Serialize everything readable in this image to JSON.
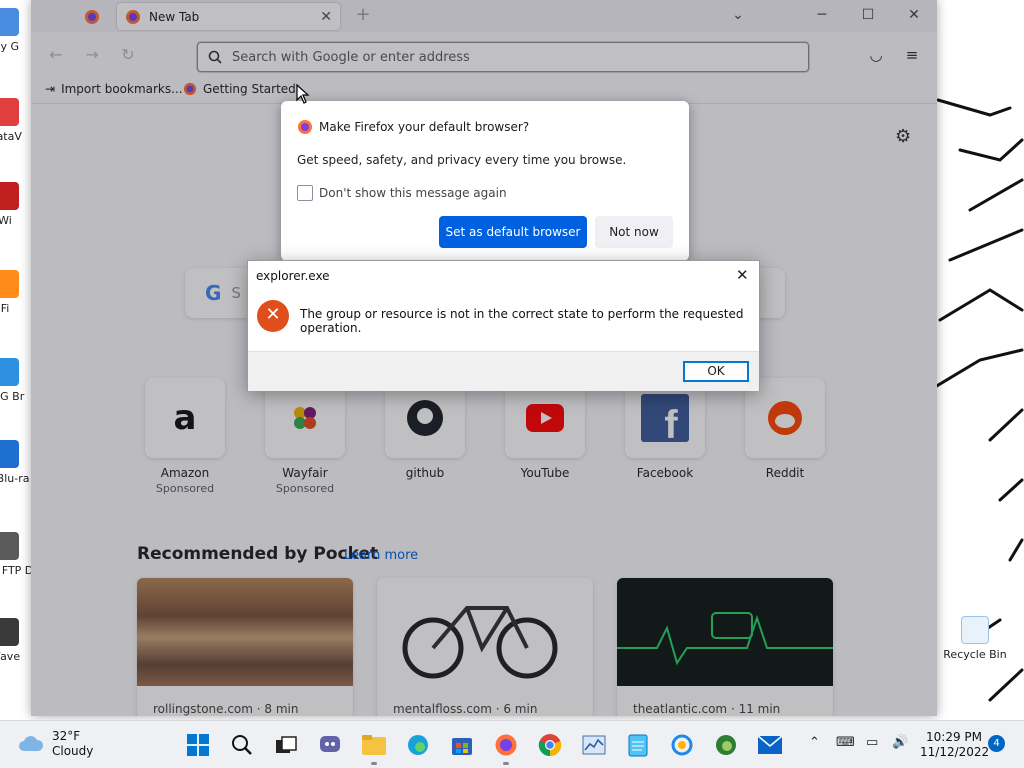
{
  "desktop": {
    "icons": [
      {
        "label": "My G"
      },
      {
        "label": "DataV"
      },
      {
        "label": "Wi"
      },
      {
        "label": "Fi"
      },
      {
        "label": "AVG Br"
      },
      {
        "label": "Le Blu-ra"
      },
      {
        "label": "Guil FTP D"
      },
      {
        "label": "Wave"
      }
    ],
    "recycle_bin": "Recycle Bin"
  },
  "firefox": {
    "tab_title": "New Tab",
    "url_placeholder": "Search with Google or enter address",
    "bookmarks": [
      "Import bookmarks...",
      "Getting Started"
    ],
    "search_placeholder": "S",
    "top_sites": [
      {
        "name": "Amazon",
        "sponsored": "Sponsored"
      },
      {
        "name": "Wayfair",
        "sponsored": "Sponsored"
      },
      {
        "name": "github",
        "sponsored": ""
      },
      {
        "name": "YouTube",
        "sponsored": ""
      },
      {
        "name": "Facebook",
        "sponsored": ""
      },
      {
        "name": "Reddit",
        "sponsored": ""
      }
    ],
    "pocket": {
      "title": "Recommended by Pocket",
      "learn_more": "Learn more",
      "cards": [
        {
          "source": "rollingstone.com · 8 min"
        },
        {
          "source": "mentalfloss.com · 6 min"
        },
        {
          "source": "theatlantic.com · 11 min"
        }
      ]
    }
  },
  "default_modal": {
    "title": "Make Firefox your default browser?",
    "body": "Get speed, safety, and privacy every time you browse.",
    "checkbox": "Don't show this message again",
    "primary": "Set as default browser",
    "secondary": "Not now"
  },
  "error_dialog": {
    "title": "explorer.exe",
    "message": "The group or resource is not in the correct state to perform the requested operation.",
    "ok": "OK"
  },
  "taskbar": {
    "weather_temp": "32°F",
    "weather_desc": "Cloudy",
    "time": "10:29 PM",
    "date": "11/12/2022",
    "notifications": "4"
  },
  "colors": {
    "accent": "#0061e0",
    "error": "#e04e1b",
    "windows_blue": "#0078d4"
  }
}
